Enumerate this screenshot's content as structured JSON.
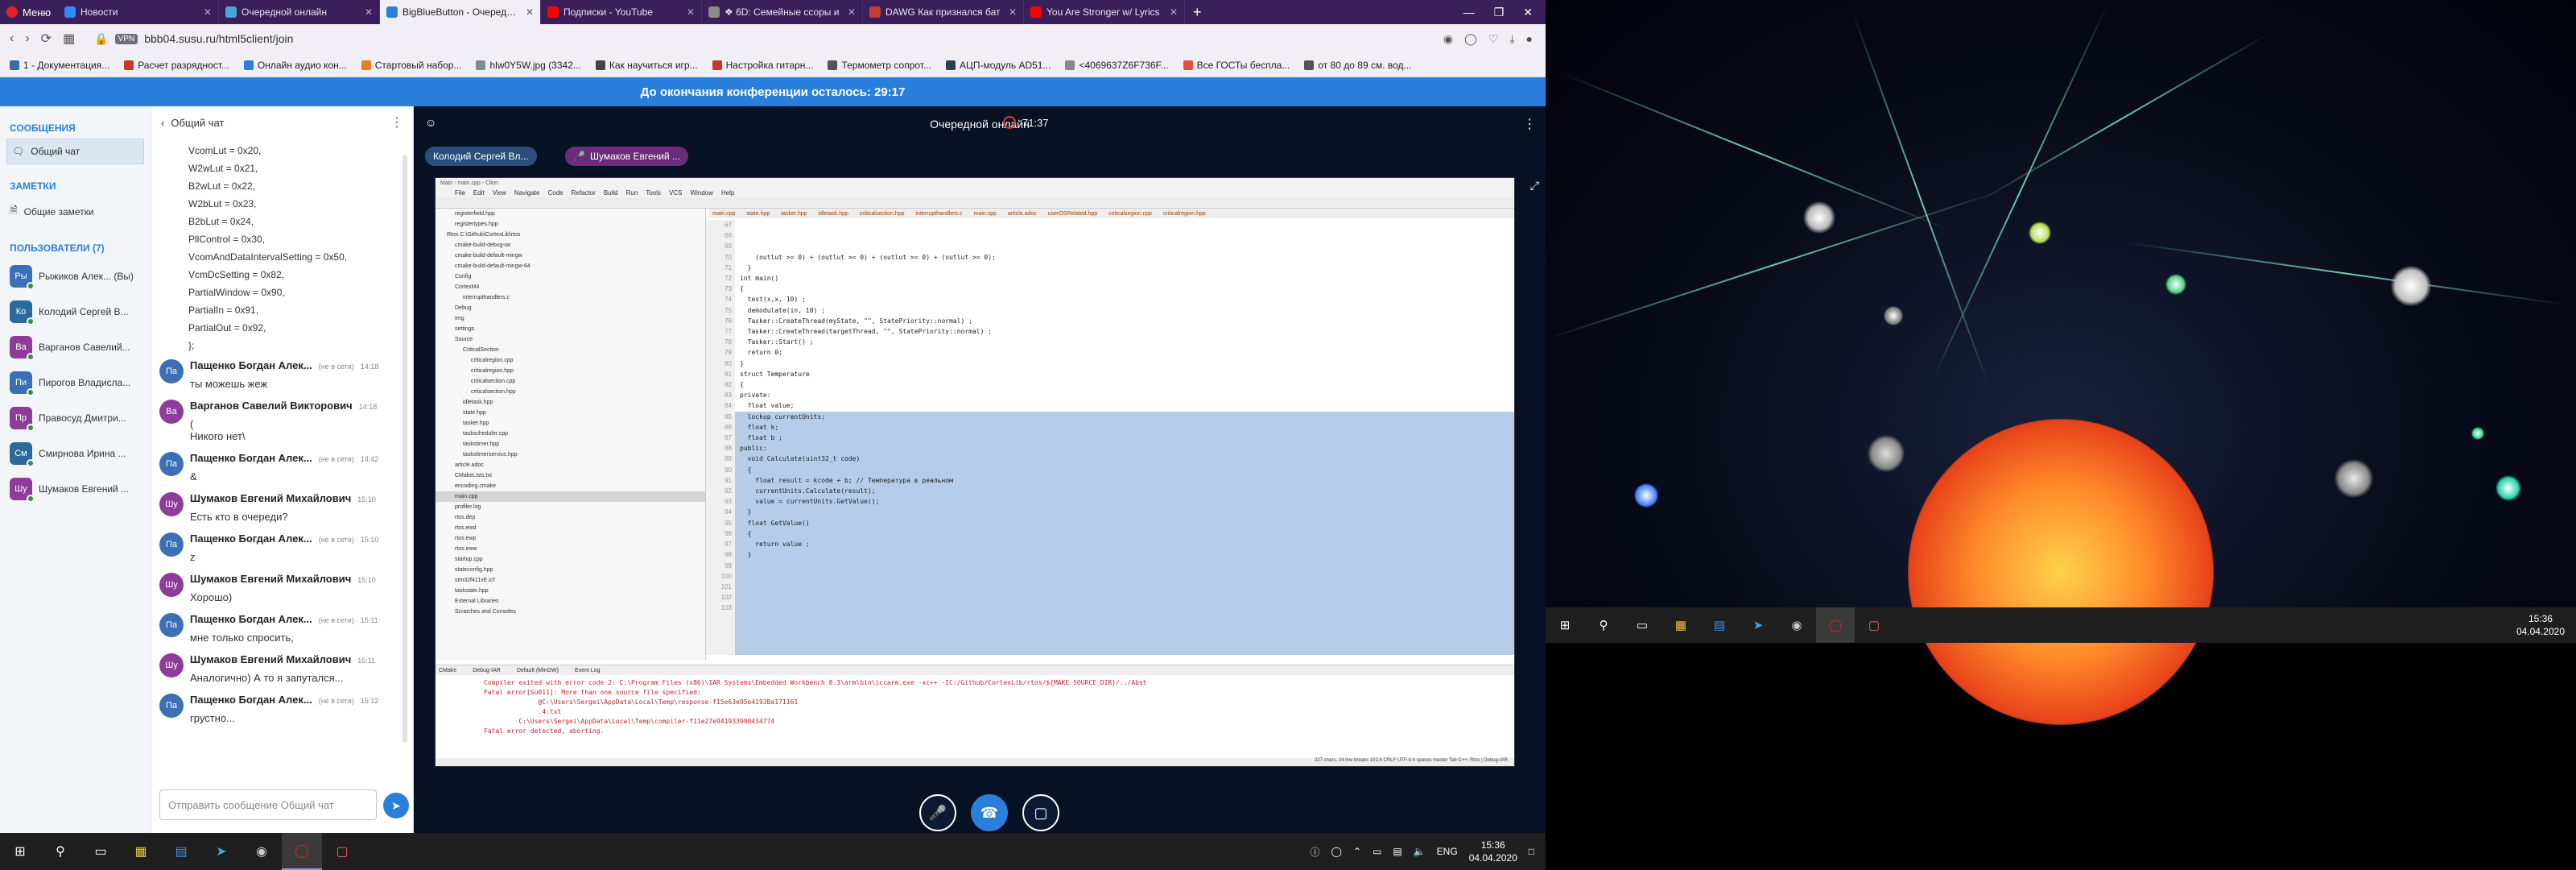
{
  "browser": {
    "menu_label": "Меню",
    "tabs": [
      {
        "title": "Новости",
        "color": "#2d8cff"
      },
      {
        "title": "Очередной онлайн",
        "color": "#4aa3df"
      },
      {
        "title": "BigBlueButton - Очередной онлайн",
        "color": "#2a7fdc"
      },
      {
        "title": "Подписки - YouTube",
        "color": "#ff0000"
      },
      {
        "title": "❖ 6D: Семейные ссоры и",
        "color": "#8a8a8a"
      },
      {
        "title": "DAWG Как признался бат",
        "color": "#c23a3a"
      },
      {
        "title": "You Are Stronger w/ Lyrics",
        "color": "#ff0000"
      }
    ],
    "new_tab": "+",
    "url_badge": "VPN",
    "url": "bbb04.susu.ru/html5client/join",
    "bookmarks": [
      "1 - Документация...",
      "Расчет разрядност...",
      "Онлайн аудио кон...",
      "Стартовый набор...",
      "hlw0Y5W.jpg (3342...",
      "Как научиться игр...",
      "Настройка гитарн...",
      "Термометр сопрот...",
      "АЦП-модуль AD51...",
      "<4069637Z6F736F...",
      "Все ГОСТы беспла...",
      "от 80 до 89 см. вод..."
    ]
  },
  "banner": "До окончания конференции осталось: 29:17",
  "sidebar": {
    "messages_header": "СООБЩЕНИЯ",
    "public_chat": "Общий чат",
    "notes_header": "ЗАМЕТКИ",
    "shared_notes": "Общие заметки",
    "users_header": "ПОЛЬЗОВАТЕЛИ (7)",
    "users": [
      {
        "initials": "Ры",
        "name": "Рыжиков Алек... (Вы)",
        "color": "#3b6fb6"
      },
      {
        "initials": "Ко",
        "name": "Колодий Сергей В...",
        "color": "#2b6a9a"
      },
      {
        "initials": "Ва",
        "name": "Варганов Савелий...",
        "color": "#8e3c9a"
      },
      {
        "initials": "Пи",
        "name": "Пирогов Владисла...",
        "color": "#3b6fb6"
      },
      {
        "initials": "Пр",
        "name": "Правосуд Дмитри...",
        "color": "#8e3c9a"
      },
      {
        "initials": "См",
        "name": "Смирнова Ирина ...",
        "color": "#2b6a9a"
      },
      {
        "initials": "Шу",
        "name": "Шумаков Евгений ...",
        "color": "#8e3c9a"
      }
    ]
  },
  "chat": {
    "back_label": "Общий чат",
    "code_lines": [
      "VcomLut = 0x20,",
      "W2wLut = 0x21,",
      "B2wLut = 0x22,",
      "W2bLut = 0x23,",
      "B2bLut = 0x24,",
      "PllControl = 0x30,",
      "VcomAndDataIntervalSetting = 0x50,",
      "VcmDcSetting = 0x82,",
      "PartialWindow = 0x90,",
      "PartialIn = 0x91,",
      "PartialOut = 0x92,",
      "};"
    ],
    "messages": [
      {
        "initials": "Па",
        "name": "Пащенко Богдан Алек...",
        "time": "14:18",
        "text": "ты можешь жеж",
        "color": "#3b6fb6"
      },
      {
        "initials": "Ва",
        "name": "Варганов Савелий Викторович",
        "time": "14:18",
        "text": "(\nНикого нет\\",
        "color": "#8e3c9a"
      },
      {
        "initials": "Па",
        "name": "Пащенко Богдан Алек...",
        "time": "14:42",
        "text": "&",
        "color": "#3b6fb6"
      },
      {
        "initials": "Шу",
        "name": "Шумаков Евгений Михайлович",
        "time": "15:10",
        "text": "Есть кто в очереди?",
        "color": "#8e3c9a"
      },
      {
        "initials": "Па",
        "name": "Пащенко Богдан Алек...",
        "time": "15:10",
        "text": "z",
        "color": "#3b6fb6"
      },
      {
        "initials": "Шу",
        "name": "Шумаков Евгений Михайлович",
        "time": "15:10",
        "text": "Хорошо)",
        "color": "#8e3c9a"
      },
      {
        "initials": "Па",
        "name": "Пащенко Богдан Алек...",
        "time": "15:11",
        "text": "мне только спросить,",
        "color": "#3b6fb6"
      },
      {
        "initials": "Шу",
        "name": "Шумаков Евгений Михайлович",
        "time": "15:11",
        "text": "Аналогично) А то я запутался...",
        "color": "#8e3c9a"
      },
      {
        "initials": "Па",
        "name": "Пащенко Богдан Алек...",
        "time": "15:12",
        "text": "грустно...",
        "color": "#3b6fb6"
      }
    ],
    "offline_tag": "(не в сети)",
    "input_placeholder": "Отправить сообщение Общий чат"
  },
  "presentation": {
    "title": "Очередной онлайн",
    "record_time": "71:37",
    "talkers": [
      {
        "name": "Колодий Сергей Вл...",
        "color": "#2b4f7a"
      },
      {
        "name": "Шумаков Евгений ...",
        "color": "#6b2c7a"
      }
    ]
  },
  "ide": {
    "title_bar": "Main - main.cpp - Clion",
    "menu": [
      "File",
      "Edit",
      "View",
      "Navigate",
      "Code",
      "Refactor",
      "Build",
      "Run",
      "Tools",
      "VCS",
      "Window",
      "Help"
    ],
    "tabs": [
      "main.cpp",
      "state.hpp",
      "tasker.hpp",
      "idletask.hpp",
      "criticalsection.hpp",
      "interrupthandlers.c",
      "main.cpp",
      "article.adoc",
      "userOSRelated.hpp",
      "criticalsegion.cpp",
      "criticalregion.hpp"
    ],
    "tree": [
      "registerfield.hpp",
      "registertypes.hpp",
      "Rtos  C:\\Github\\CortexLib\\rtos",
      "cmake-build-debug-iar",
      "cmake-build-default-mingw",
      "cmake-build-default-mingw-64",
      "Config",
      "CortexM4",
      "interrupthandlers.c",
      "Debug",
      "Img",
      "settings",
      "Source",
      "CriticalSection",
      "criticalregion.cpp",
      "criticalregion.hpp",
      "criticalsection.cpp",
      "criticalsection.hpp",
      "idletask.hpp",
      "state.hpp",
      "tasker.hpp",
      "taskscheduler.cpp",
      "taskstimer.hpp",
      "taskstimerservice.hpp",
      "article.adoc",
      "CMakeLists.txt",
      "encoding.cmake",
      "main.cpp",
      "profiler.log",
      "rtos.dep",
      "rtos.ewd",
      "rtos.ewp",
      "rtos.eww",
      "startup.cpp",
      "stateconfig.hpp",
      "stm32f411xE.icf",
      "taskstate.hpp",
      "External Libraries",
      "Scratches and Consoles"
    ],
    "gutter_start": 67,
    "code": [
      "    (outlut >= 0) + (outlut >= 0) + (outlut >= 0) + (outlut >= 0);",
      "  }",
      "",
      "int main()",
      "{",
      "  test(x,x, 10) ;",
      "  demodulate(in, 10) ;",
      "  Tasker::CreateThread(myState, \"\", StatePriority::normal) ;",
      "  Tasker::CreateThread(targetThread, \"\", StatePriority::normal) ;",
      "  Tasker::Start() ;",
      "  return 0;",
      "}",
      "",
      "",
      "",
      "struct Temperature",
      "{",
      "private:",
      "  float value;",
      "  lockup currentUnits;",
      "  float k;",
      "  float b ;",
      "public:",
      "  void Calculate(uint32_t code)",
      "  {",
      "    float result = kcode + b; // Температура в реальном",
      "    currentUnits.Calculate(result);",
      "    value = currentUnits.GetValue();",
      "  }",
      "",
      "  float GetValue()",
      "  {",
      "    return value ;",
      "  }",
      "",
      "",
      ""
    ],
    "bottom_tabs": [
      "CMake",
      "Debug-IAR",
      "Default (MinGW)",
      "Event Log"
    ],
    "errors": [
      "Compiler exited with error code 2: C:\\Program Files (x86)\\IAR Systems\\Embedded Workbench 8.3\\arm\\bin\\iccarm.exe -xc++ -IC:/Github/CortexLib/rtos/${MAKE_SOURCE_DIR}/../Abst",
      "Fatal error[Su011]: More than one source file specified:",
      "              @C:\\Users\\Sergei\\AppData\\Local\\Temp\\response-f15e63e95e4193Ba171161",
      "              .4.txt",
      "         C:\\Users\\Sergei\\AppData\\Local\\Temp\\compiler-f11e27e941933998434774",
      "Fatal error detected, aborting."
    ],
    "status_bar": "327 chars, 24 line breaks   101:4   CRLF   UTF-8   4 spaces   master   Tab   C++: Rtos | Debug-IAR"
  },
  "taskbar": {
    "lang": "ENG",
    "time": "15:36",
    "date": "04.04.2020"
  },
  "taskbar2": {
    "time": "15:36",
    "date": "04.04.2020"
  }
}
